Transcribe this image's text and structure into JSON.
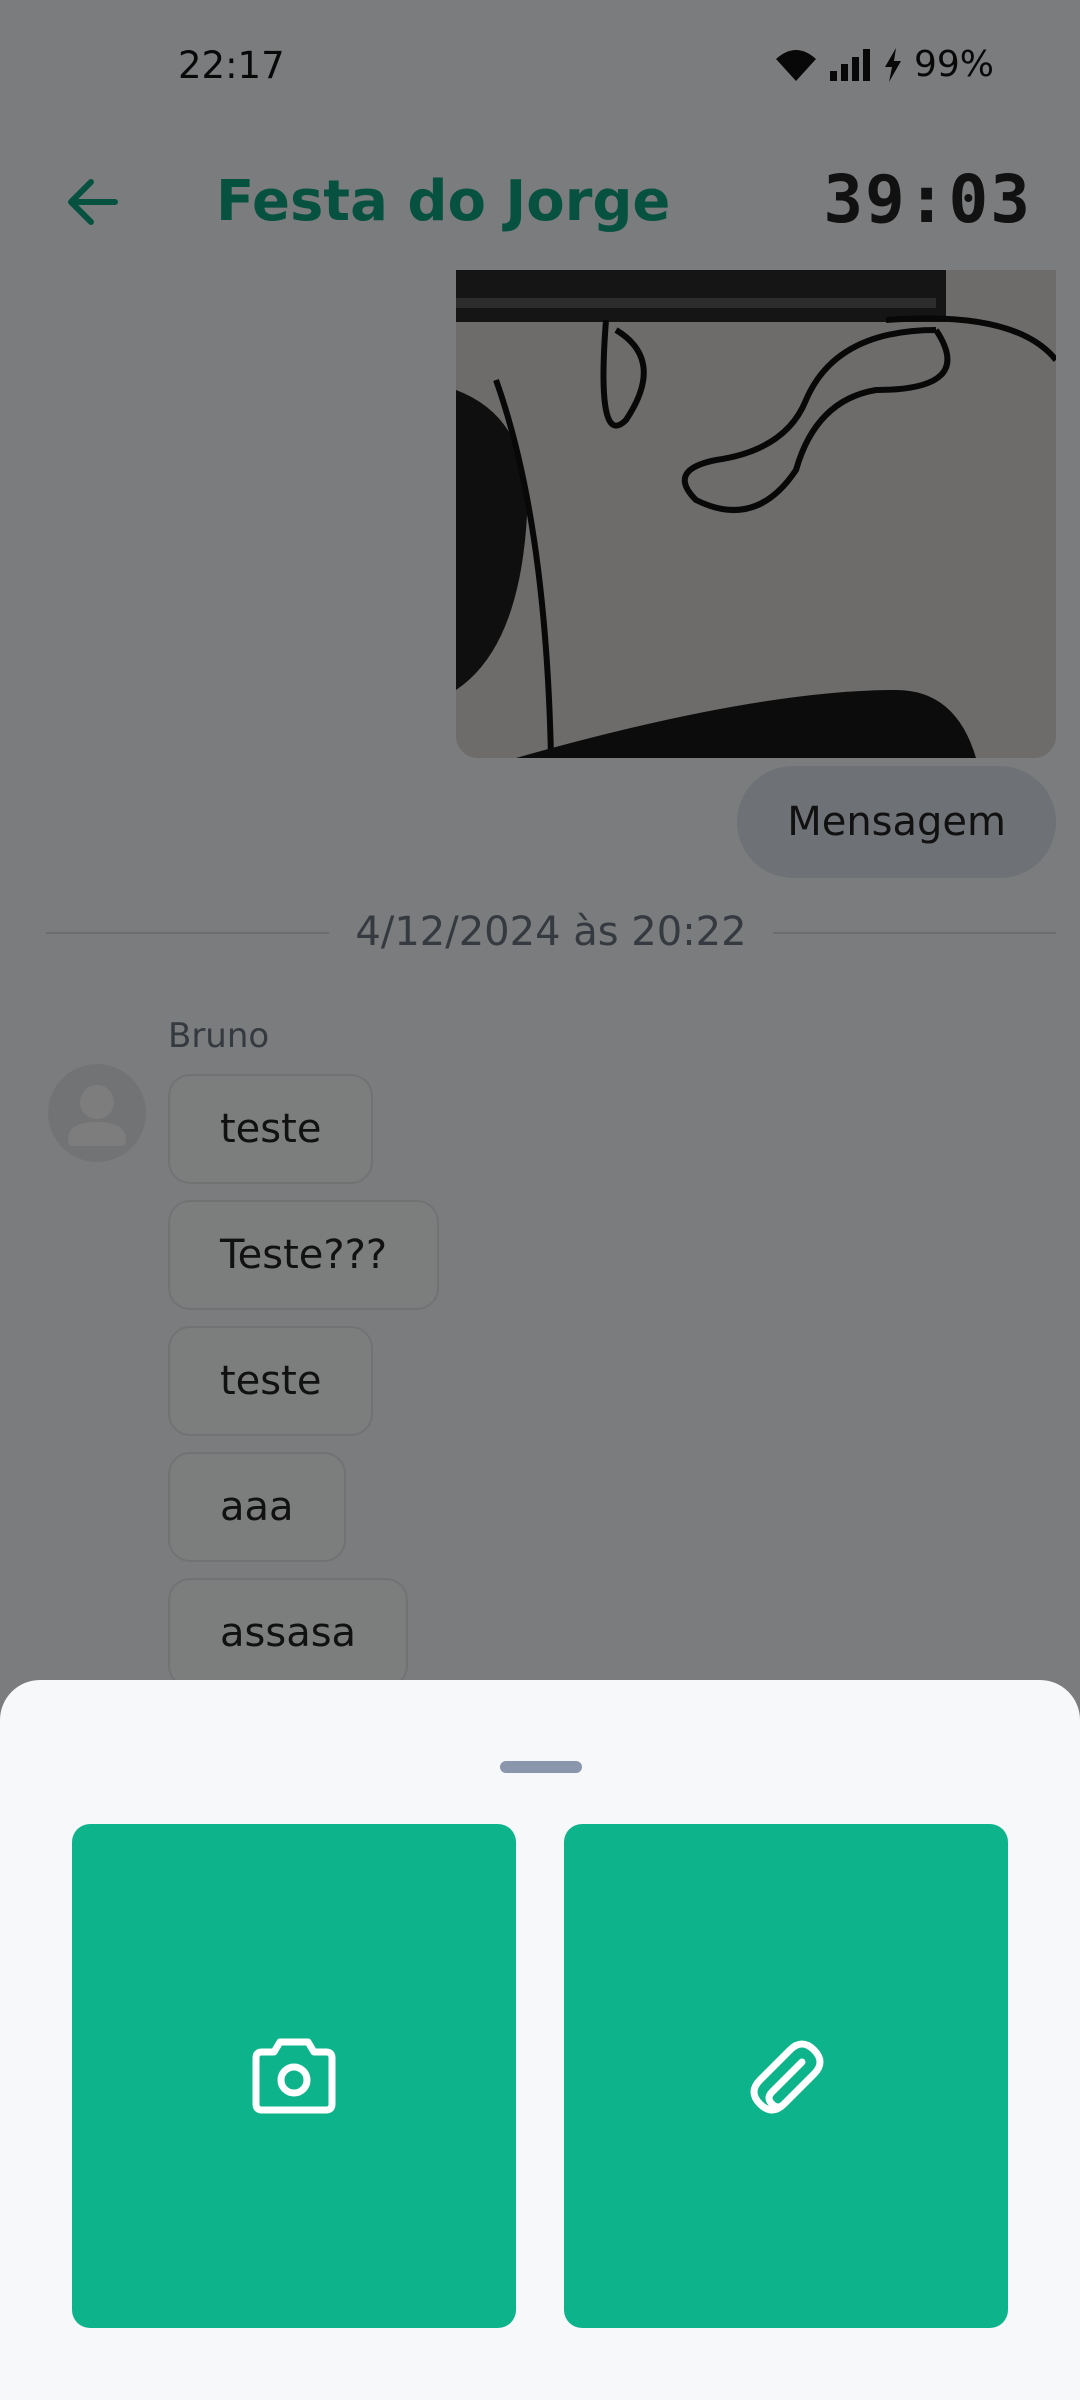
{
  "status_bar": {
    "time": "22:17",
    "battery": "99%",
    "icons": [
      "wifi-icon",
      "signal-icon",
      "charging-icon"
    ]
  },
  "header": {
    "back_icon": "arrow-left-icon",
    "title": "Festa do Jorge",
    "timer": "39:03"
  },
  "chat": {
    "outgoing_message": "Mensagem",
    "date_separator": "4/12/2024 às 20:22",
    "group": {
      "sender": "Bruno",
      "messages": [
        "teste",
        "Teste???",
        "teste",
        "aaa",
        "assasa"
      ]
    }
  },
  "sheet": {
    "actions": [
      {
        "name": "camera",
        "icon": "camera-icon"
      },
      {
        "name": "attachment",
        "icon": "paperclip-icon"
      }
    ]
  },
  "colors": {
    "accent": "#0fa380",
    "button": "#0db38a",
    "overlay": "rgba(0,0,0,0.5)"
  }
}
